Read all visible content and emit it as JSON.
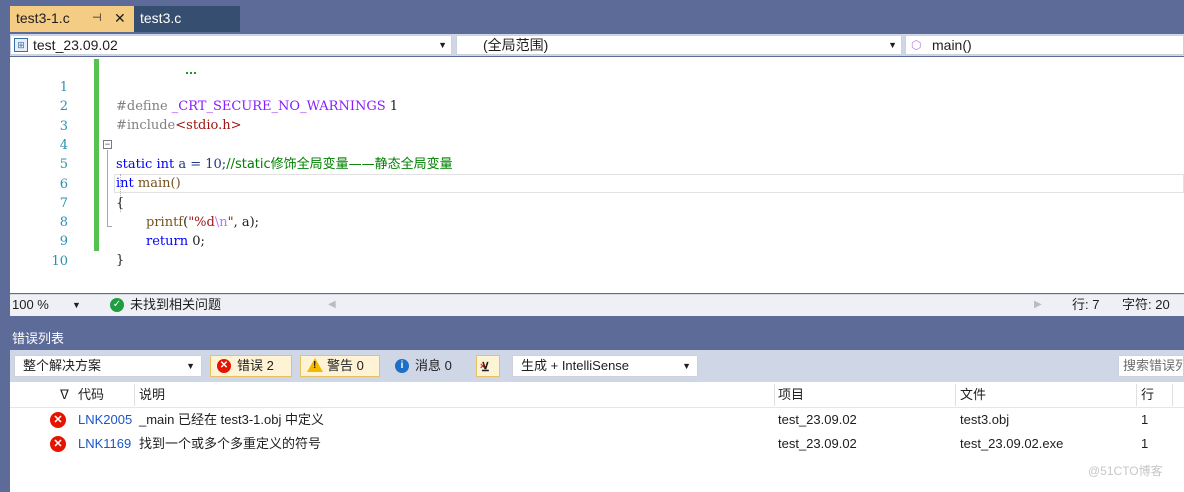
{
  "tabs": [
    {
      "label": "test3-1.c",
      "pin": "⊣",
      "close": "✕"
    },
    {
      "label": "test3.c"
    }
  ],
  "nav": {
    "project": "test_23.09.02",
    "scope": "(全局范围)",
    "member": "main()"
  },
  "editor": {
    "line_numbers": [
      "1",
      "2",
      "3",
      "4",
      "5",
      "6",
      "7",
      "8",
      "9",
      "10"
    ],
    "lines": {
      "l1_dir": "#define ",
      "l1_macro": "_CRT_SECURE_NO_WARNINGS",
      "l1_val": " 1",
      "l2_dir": "#include",
      "l2_hdr": "<stdio.h>",
      "l4_kw1": "static",
      "l4_sp1": " ",
      "l4_kw2": "int",
      "l4_rest": " a = 10;",
      "l4_comment": "//static修饰全局变量——静态全局变量",
      "l5_kw": "int",
      "l5_rest": " main()",
      "l6": "{",
      "l7_fn": "printf",
      "l7_open": "(",
      "l7_str1": "\"%d",
      "l7_esc": "\\n",
      "l7_str2": "\"",
      "l7_rest": ", a);",
      "l8_kw": "return",
      "l8_rest": " 0;",
      "l9": "}"
    }
  },
  "status": {
    "zoom": "100 %",
    "issues": "未找到相关问题",
    "row": "行: 7",
    "char": "字符: 20"
  },
  "error_list": {
    "title": "错误列表",
    "scope": "整个解决方案",
    "errors_btn": "错误 2",
    "warnings_btn": "警告 0",
    "messages_btn": "消息 0",
    "build_filter": "生成 + IntelliSense",
    "search_placeholder": "搜索错误列",
    "columns": {
      "code": "代码",
      "desc": "说明",
      "project": "项目",
      "file": "文件",
      "line": "行"
    },
    "rows": [
      {
        "code": "LNK2005",
        "desc": "_main 已经在 test3-1.obj 中定义",
        "project": "test_23.09.02",
        "file": "test3.obj",
        "line": "1"
      },
      {
        "code": "LNK1169",
        "desc": "找到一个或多个多重定义的符号",
        "project": "test_23.09.02",
        "file": "test_23.09.02.exe",
        "line": "1"
      }
    ]
  },
  "watermark": "@51CTO博客",
  "colors": {
    "accent_tab": "#f5cc84",
    "chrome": "#5d6b99",
    "error": "#e51400",
    "warning": "#f5b800",
    "info": "#1e6fc7",
    "ok": "#1e9e3e",
    "change_bar": "#57c24f"
  }
}
